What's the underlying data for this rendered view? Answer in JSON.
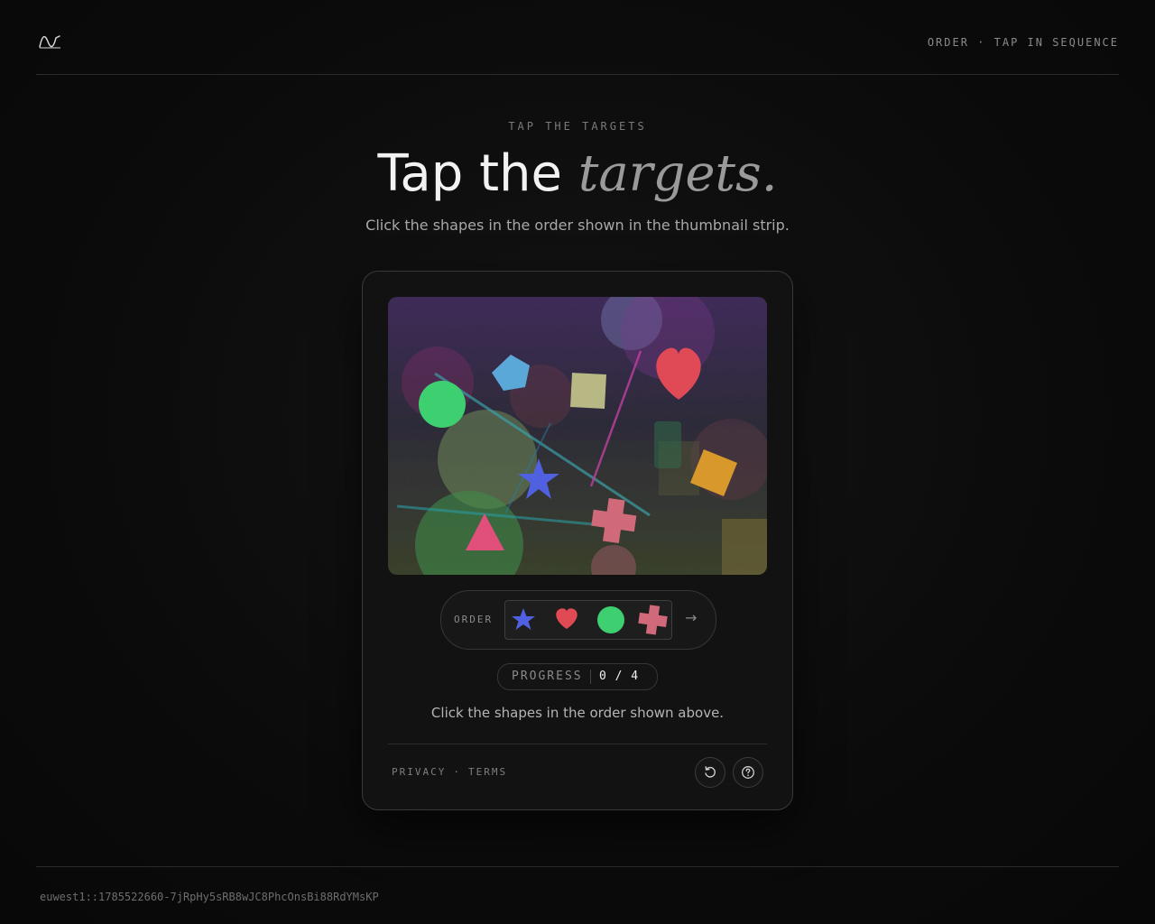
{
  "header": {
    "logo_icon": "wave-logo-icon",
    "mode_label": "ORDER · TAP IN SEQUENCE"
  },
  "hero": {
    "eyebrow": "TAP THE TARGETS",
    "title_plain": "Tap the",
    "title_italic": "targets.",
    "subtitle": "Click the shapes in the order shown in the thumbnail strip."
  },
  "challenge": {
    "canvas_shapes": [
      "pentagon",
      "square",
      "heart",
      "circle",
      "star",
      "diamond",
      "triangle",
      "cross"
    ],
    "order_label": "ORDER",
    "order_sequence": [
      "star",
      "heart",
      "circle",
      "cross"
    ],
    "order_colors": [
      "#5060e0",
      "#e0505e",
      "#3ed070",
      "#d06a7a"
    ],
    "order_arrow": "→",
    "progress_label": "PROGRESS",
    "progress_value": "0 / 4",
    "progress_done": 0,
    "progress_total": 4,
    "instruction": "Click the shapes in the order shown above."
  },
  "footer": {
    "privacy": "PRIVACY",
    "separator": "·",
    "terms": "TERMS",
    "reload_icon": "reload-icon",
    "help_icon": "help-icon"
  },
  "page_footer": {
    "ray_id": "euwest1::1785522660-7jRpHy5sRB8wJC8PhcOnsBi88RdYMsKP"
  }
}
